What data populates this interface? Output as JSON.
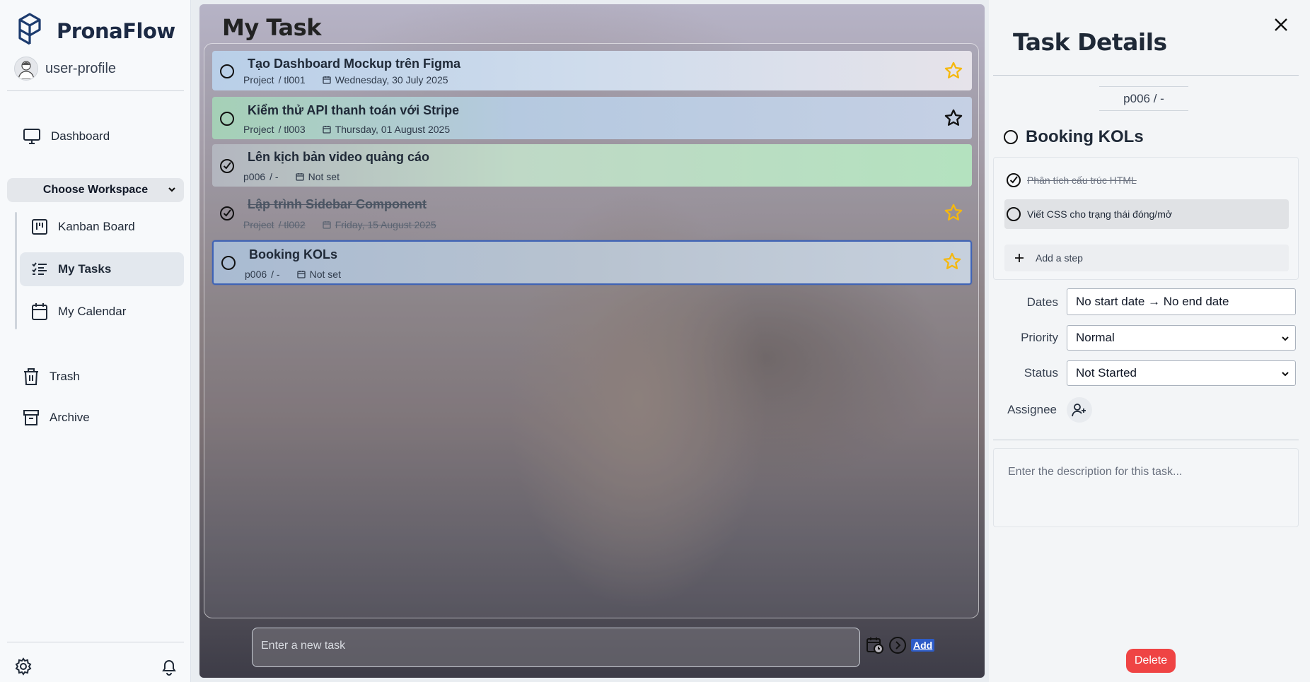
{
  "app": {
    "name": "PronaFlow"
  },
  "profile": {
    "name": "user-profile"
  },
  "nav": {
    "dashboard": "Dashboard",
    "workspace_select": "Choose Workspace",
    "kanban": "Kanban Board",
    "my_tasks": "My Tasks",
    "my_calendar": "My Calendar",
    "trash": "Trash",
    "archive": "Archive"
  },
  "main": {
    "title": "My Task",
    "tasks": [
      {
        "title": "Tạo Dashboard Mockup trên Figma",
        "project": "Project",
        "id": "/ tl001",
        "date": "Wednesday, 30 July 2025",
        "done": false,
        "starred": true
      },
      {
        "title": "Kiểm thử API thanh toán với Stripe",
        "project": "Project",
        "id": "/ tl003",
        "date": "Thursday, 01 August 2025",
        "done": false,
        "starred": false
      },
      {
        "title": "Lên kịch bản video quảng cáo",
        "project": "p006",
        "id": "/ -",
        "date": "Not set",
        "done": true,
        "starred": false
      },
      {
        "title": "Lập trình Sidebar Component",
        "project": "Project",
        "id": "/ tl002",
        "date": "Friday, 15 August 2025",
        "done": true,
        "starred": true
      },
      {
        "title": "Booking KOLs",
        "project": "p006",
        "id": "/ -",
        "date": "Not set",
        "done": false,
        "starred": true,
        "selected": true
      }
    ],
    "add_placeholder": "Enter a new task",
    "add_button": "Add"
  },
  "details": {
    "title": "Task Details",
    "breadcrumb": "p006 / -",
    "task_name": "Booking KOLs",
    "steps": [
      {
        "label": "Phân tích cấu trúc HTML",
        "done": true
      },
      {
        "label": "Viết CSS cho trạng thái đóng/mở",
        "done": false
      }
    ],
    "add_step": "Add a step",
    "dates_label": "Dates",
    "dates_value": "No start date → No end date",
    "priority_label": "Priority",
    "priority_value": "Normal",
    "status_label": "Status",
    "status_value": "Not Started",
    "assignee_label": "Assignee",
    "description_placeholder": "Enter the description for this task...",
    "delete_button": "Delete"
  },
  "colors": {
    "accent": "#2d5cc8",
    "star": "#f5b80f",
    "delete": "#ef4444",
    "selected_border": "#3f63b5"
  }
}
